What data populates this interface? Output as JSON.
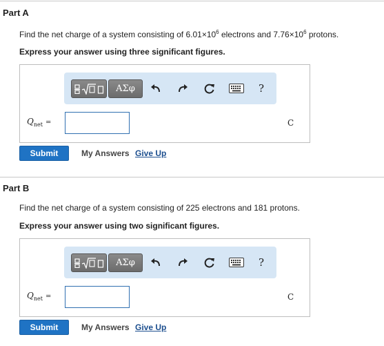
{
  "parts": [
    {
      "title": "Part A",
      "question": {
        "prefix": "Find the net charge of a system consisting of 6.01×10",
        "exp1": "6",
        "middle": " electrons and 7.76×10",
        "exp2": "6",
        "suffix": " protons."
      },
      "instruction": "Express your answer using three significant figures.",
      "toolbar": {
        "symbols_label": "ΑΣφ",
        "help_label": "?"
      },
      "variable": {
        "symbol": "Q",
        "subscript": "net",
        "equals": "="
      },
      "input_value": "",
      "unit": "C",
      "submit_label": "Submit",
      "my_answers_label": "My Answers",
      "give_up_label": "Give Up"
    },
    {
      "title": "Part B",
      "question": {
        "text": "Find the net charge of a system consisting of 225 electrons and 181 protons."
      },
      "instruction": "Express your answer using two significant figures.",
      "toolbar": {
        "symbols_label": "ΑΣφ",
        "help_label": "?"
      },
      "variable": {
        "symbol": "Q",
        "subscript": "net",
        "equals": "="
      },
      "input_value": "",
      "unit": "C",
      "submit_label": "Submit",
      "my_answers_label": "My Answers",
      "give_up_label": "Give Up"
    }
  ],
  "colors": {
    "submit_bg": "#1f73c4",
    "toolbar_bg": "#d6e6f5",
    "link": "#1d4f8f",
    "input_border": "#2f6fb0"
  }
}
